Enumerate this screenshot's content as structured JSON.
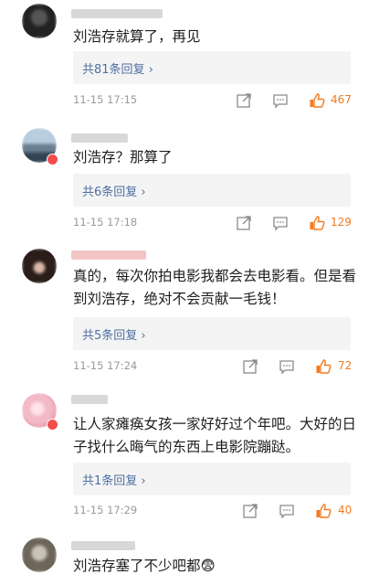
{
  "comments": [
    {
      "text": "刘浩存就算了，再见",
      "reply_label": "共81条回复",
      "time": "11-15 17:15",
      "likes": "467",
      "avatar_colors": [
        "#3a3a3a",
        "#7a7a7a"
      ]
    },
    {
      "text": "刘浩存？那算了",
      "reply_label": "共6条回复",
      "time": "11-15 17:18",
      "likes": "129",
      "avatar_colors": [
        "#9fb8cf",
        "#5a6d80"
      ]
    },
    {
      "text": "真的，每次你拍电影我都会去电影看。但是看到刘浩存，绝对不会贡献一毛钱！",
      "reply_label": "共5条回复",
      "time": "11-15 17:24",
      "likes": "72",
      "avatar_colors": [
        "#2a1d1a",
        "#c8a79a"
      ]
    },
    {
      "text": "让人家瘫痪女孩一家好好过个年吧。大好的日子找什么晦气的东西上电影院蹦跶。",
      "reply_label": "共1条回复",
      "time": "11-15 17:29",
      "likes": "40",
      "avatar_colors": [
        "#f6c9d4",
        "#e6a0b0"
      ]
    },
    {
      "text": "刘浩存塞了不少吧都",
      "emoji": "😨",
      "avatar_colors": [
        "#c9c2b8",
        "#6e655a"
      ]
    }
  ],
  "icons": [
    "share-icon",
    "comment-icon",
    "like-thumb-icon",
    "chevron-right-icon"
  ],
  "accent_colors": {
    "reply_link": "#4f6fa2",
    "like": "#f37a1f",
    "meta": "#9a9a9a"
  }
}
